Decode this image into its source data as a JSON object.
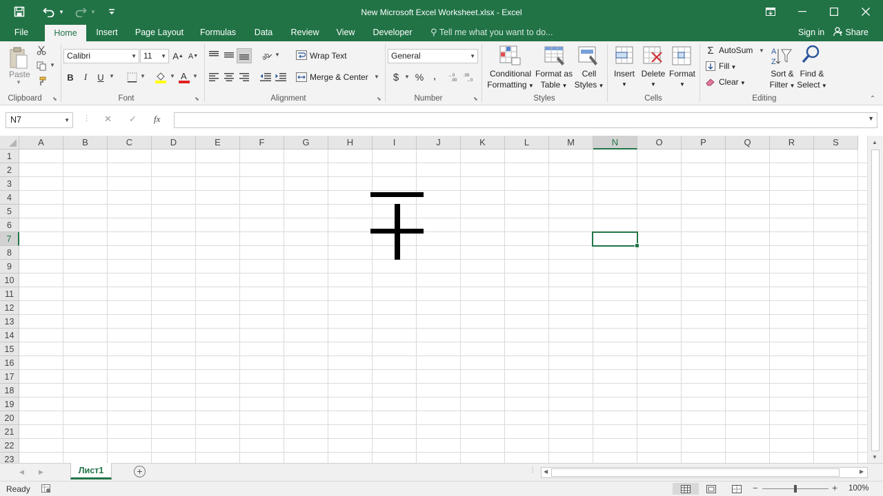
{
  "window": {
    "title": "New Microsoft Excel Worksheet.xlsx - Excel",
    "controls": [
      "restore-ribbon",
      "minimize",
      "maximize",
      "close"
    ]
  },
  "ribbon_tabs": [
    {
      "label": "File",
      "active": false
    },
    {
      "label": "Home",
      "active": true
    },
    {
      "label": "Insert",
      "active": false
    },
    {
      "label": "Page Layout",
      "active": false
    },
    {
      "label": "Formulas",
      "active": false
    },
    {
      "label": "Data",
      "active": false
    },
    {
      "label": "Review",
      "active": false
    },
    {
      "label": "View",
      "active": false
    },
    {
      "label": "Developer",
      "active": false
    }
  ],
  "tell_me": "Tell me what you want to do...",
  "sign_in": "Sign in",
  "share": "Share",
  "groups": {
    "clipboard": {
      "label": "Clipboard",
      "paste": "Paste"
    },
    "font": {
      "label": "Font",
      "font_name": "Calibri",
      "font_size": "11",
      "bold": "B",
      "italic": "I",
      "underline": "U"
    },
    "alignment": {
      "label": "Alignment",
      "wrap_text": "Wrap Text",
      "merge_center": "Merge & Center"
    },
    "number": {
      "label": "Number",
      "format": "General",
      "currency": "$",
      "percent": "%"
    },
    "styles": {
      "label": "Styles",
      "conditional": [
        "Conditional",
        "Formatting"
      ],
      "format_as_table": [
        "Format as",
        "Table"
      ],
      "cell_styles": [
        "Cell",
        "Styles"
      ]
    },
    "cells": {
      "label": "Cells",
      "insert": "Insert",
      "delete": "Delete",
      "format": "Format"
    },
    "editing": {
      "label": "Editing",
      "autosum": "AutoSum",
      "fill": "Fill",
      "clear": "Clear",
      "sort_filter": [
        "Sort &",
        "Filter"
      ],
      "find_select": [
        "Find &",
        "Select"
      ]
    }
  },
  "formula_bar": {
    "name_box": "N7",
    "cancel": "✕",
    "enter": "✓",
    "fx": "fx",
    "formula": ""
  },
  "columns": [
    "A",
    "B",
    "C",
    "D",
    "E",
    "F",
    "G",
    "H",
    "I",
    "J",
    "K",
    "L",
    "M",
    "N",
    "O",
    "P",
    "Q",
    "R",
    "S"
  ],
  "rows": [
    "1",
    "2",
    "3",
    "4",
    "5",
    "6",
    "7",
    "8",
    "9",
    "10",
    "11",
    "12",
    "13",
    "14",
    "15",
    "16",
    "17",
    "18",
    "19",
    "20",
    "21",
    "22",
    "23"
  ],
  "active_cell": {
    "column": "N",
    "row": "7"
  },
  "sheets": [
    {
      "label": "Лист1",
      "active": true
    }
  ],
  "status": {
    "text": "Ready",
    "zoom": "100%"
  },
  "colors": {
    "accent": "#217346",
    "ribbon_bg": "#f3f3f3",
    "gridline": "#dadada"
  }
}
